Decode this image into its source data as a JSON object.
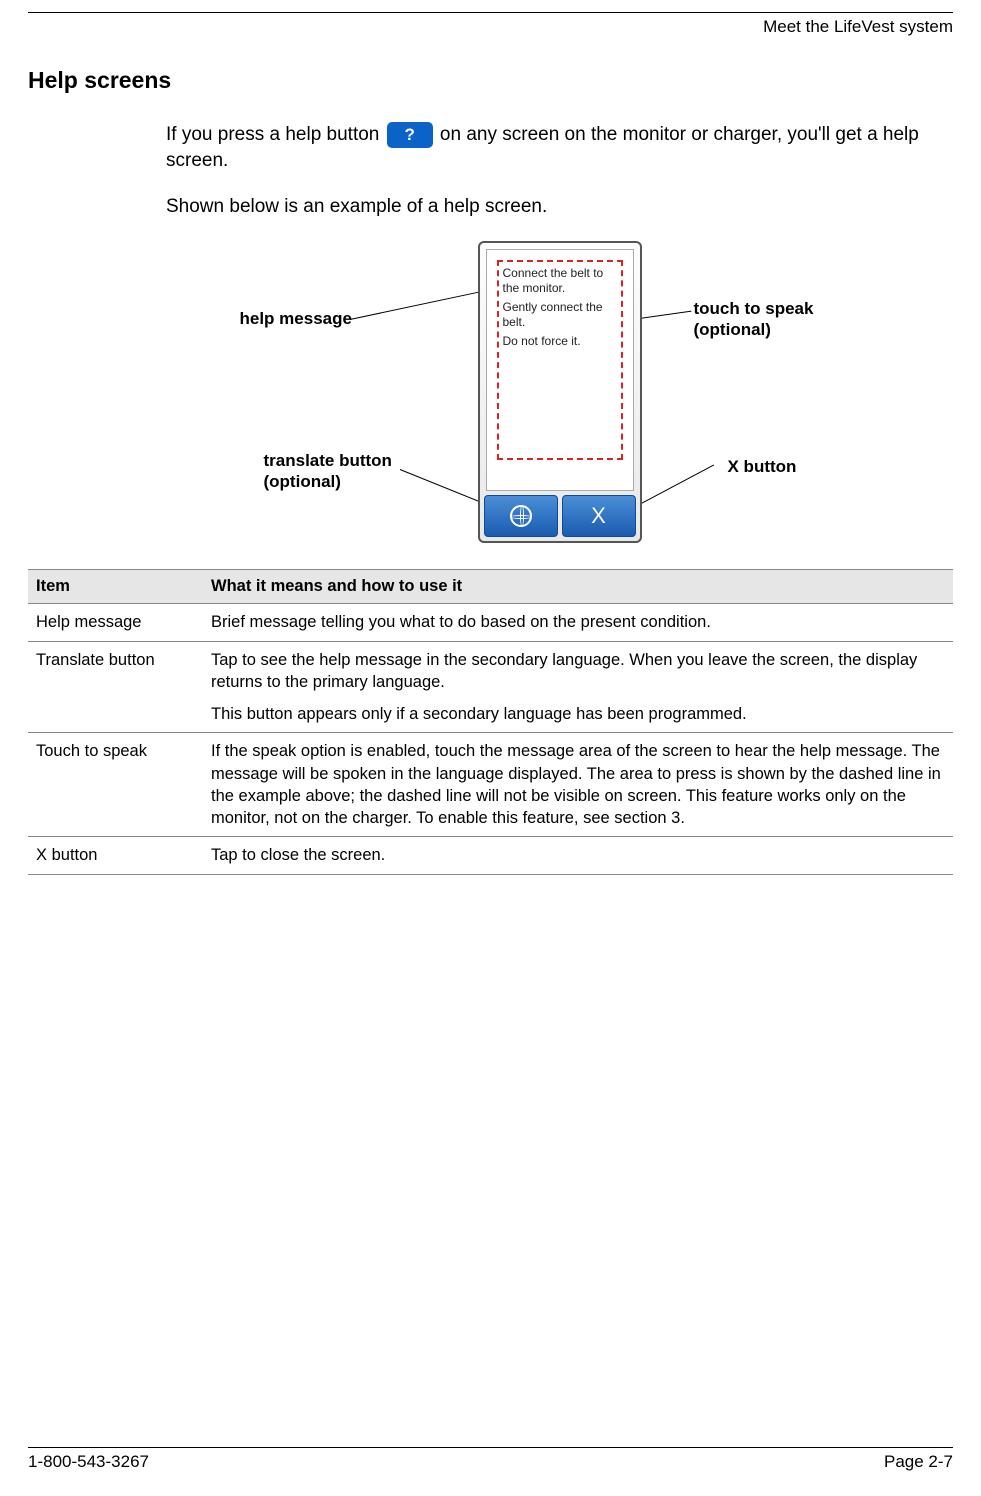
{
  "header": {
    "chapter_title": "Meet the LifeVest system"
  },
  "section": {
    "heading": "Help screens",
    "para1_pre": "If you press a help button ",
    "para1_post": " on any screen on the monitor or charger, you'll get a help screen.",
    "help_icon_glyph": "?",
    "para2": "Shown below is an example of a help screen."
  },
  "figure": {
    "callouts": {
      "help_message": "help message",
      "translate_button_line1": "translate button",
      "translate_button_line2": "(optional)",
      "touch_to_speak_line1": "touch to speak",
      "touch_to_speak_line2": "(optional)",
      "x_button": "X button"
    },
    "device_text": {
      "line1": "Connect the belt to the monitor.",
      "line2": "Gently connect the belt.",
      "line3": "Do not force it."
    },
    "x_glyph": "X"
  },
  "table": {
    "headers": {
      "item": "Item",
      "desc": "What it means and how to use it"
    },
    "rows": [
      {
        "item": "Help message",
        "desc": [
          "Brief message telling you what to do based on the present condition."
        ]
      },
      {
        "item": "Translate button",
        "desc": [
          "Tap to see the help message in the secondary language. When you leave the screen, the display returns to the primary language.",
          "This button appears only if a secondary language has been programmed."
        ]
      },
      {
        "item": "Touch to speak",
        "desc": [
          "If the speak option is enabled, touch the message area of the screen to hear the help message. The message will be spoken in the language displayed. The area to press is shown by the dashed line in the example above; the dashed line will not be visible on screen. This feature works only on the monitor, not on the charger. To enable this feature, see section 3."
        ]
      },
      {
        "item": "X button",
        "desc": [
          "Tap to close the screen."
        ]
      }
    ]
  },
  "footer": {
    "phone": "1-800-543-3267",
    "page": "Page 2-7"
  }
}
